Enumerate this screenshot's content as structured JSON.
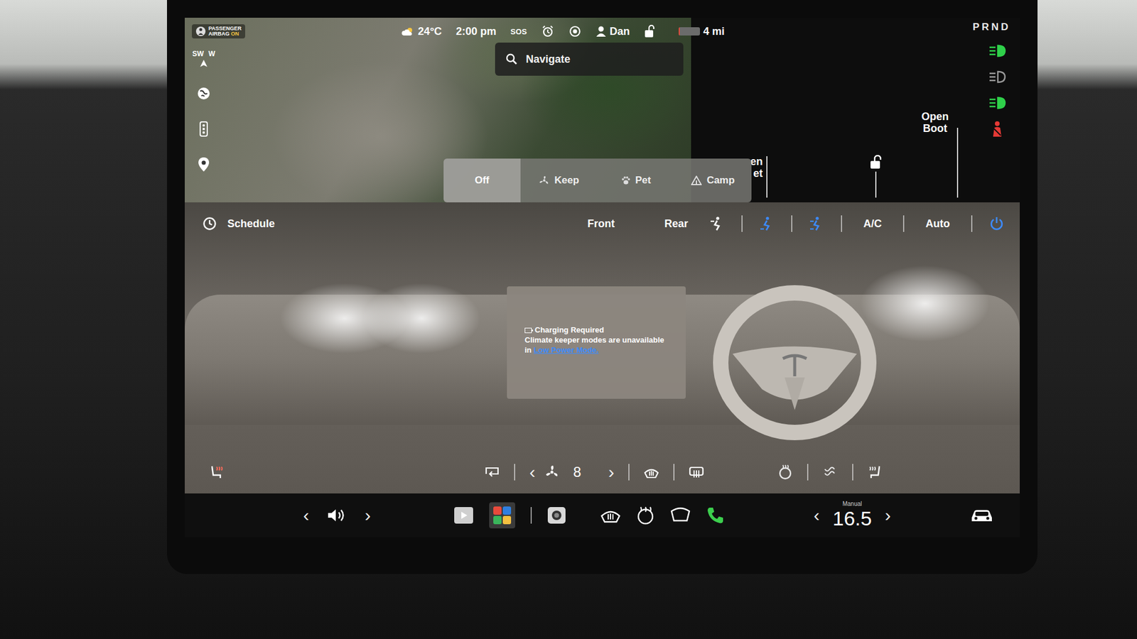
{
  "status_bar": {
    "airbag_line1": "PASSENGER",
    "airbag_line2": "AIRBAG",
    "airbag_state": "ON",
    "temperature": "24°C",
    "time": "2:00 pm",
    "sos": "SOS",
    "user": "Dan",
    "battery": {
      "level": 0.08,
      "range": "4 mi"
    }
  },
  "gears": [
    {
      "label": "P",
      "selected": false
    },
    {
      "label": "R",
      "selected": false
    },
    {
      "label": "N",
      "selected": false
    },
    {
      "label": "D",
      "selected": false
    }
  ],
  "indicators": [
    {
      "kind": "headlights",
      "on": true,
      "color": "#2fd04a"
    },
    {
      "kind": "auto-high-beam",
      "on": false,
      "color": "#c8c8c8"
    },
    {
      "kind": "side-lights",
      "on": true,
      "color": "#2fd04a"
    },
    {
      "kind": "seatbelt",
      "on": true,
      "color": "#e53935"
    }
  ],
  "map": {
    "compass": [
      "SW",
      "W"
    ],
    "search_placeholder": "Navigate"
  },
  "car_controls": {
    "bonnet_partial": [
      "en",
      "et"
    ],
    "boot": [
      "Open",
      "Boot"
    ],
    "locked": false
  },
  "climate_keeper_menu": [
    {
      "label": "Off",
      "kind": "off",
      "selected": true
    },
    {
      "label": "Keep",
      "kind": "keep",
      "selected": false
    },
    {
      "label": "Pet",
      "kind": "pet",
      "selected": false
    },
    {
      "label": "Camp",
      "kind": "camp",
      "selected": false
    }
  ],
  "climate": {
    "schedule": "Schedule",
    "zones": [
      {
        "label": "Front",
        "selected": false
      },
      {
        "label": "Rear",
        "selected": false
      }
    ],
    "airflow": [
      {
        "kind": "face",
        "selected": false
      },
      {
        "kind": "feet",
        "selected": true
      },
      {
        "kind": "face-feet",
        "selected": true
      }
    ],
    "ac": "A/C",
    "auto": "Auto",
    "power_on": true,
    "fan_speed": "8",
    "notice": {
      "title": "Charging Required",
      "body": "Climate keeper modes are unavailable",
      "prefix": "in ",
      "link": "Low Power Mode."
    },
    "passenger_seat_heat": 1,
    "heated_wheel": 0,
    "driver_seat_heat": 0,
    "seat_cooling": 0
  },
  "taskbar": {
    "mode": "Manual",
    "temperature": "16.5"
  }
}
